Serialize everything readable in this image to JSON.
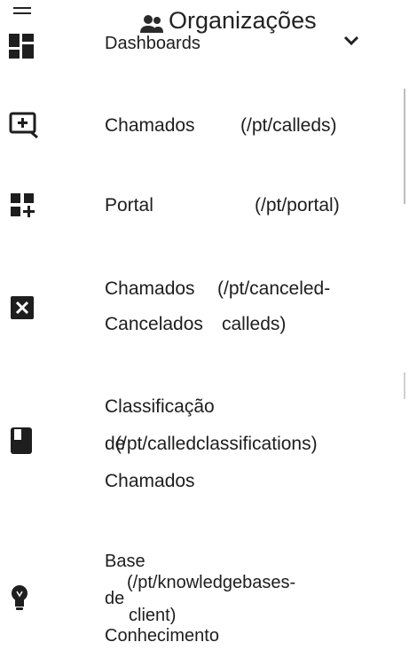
{
  "header": {
    "org_label": "Organizações"
  },
  "nav": {
    "dashboards": "Dashboards",
    "called_label": "Chamados",
    "called_path": "(/pt/calleds)",
    "portal_label": "Portal",
    "portal_path": "(/pt/portal)",
    "canceled_label_1": "Chamados",
    "canceled_label_2": "Cancelados",
    "canceled_path_1": "(/pt/canceled-",
    "canceled_path_2": "calleds)",
    "classif_label_1": "Classificação",
    "classif_label_2": "de",
    "classif_label_3": "Chamados",
    "classif_path": "(/pt/calledclassifications)",
    "kb_label_1": "Base",
    "kb_label_2": "de",
    "kb_label_3": "Conhecimento",
    "kb_path_1": "(/pt/knowledgebases-",
    "kb_path_2": "client)"
  },
  "icons": [
    "menu-icon",
    "people-icon",
    "chevron-down-icon",
    "dashboard-icon",
    "add-to-queue-icon",
    "grid-add-icon",
    "cancel-box-icon",
    "book-icon",
    "lightbulb-icon"
  ]
}
